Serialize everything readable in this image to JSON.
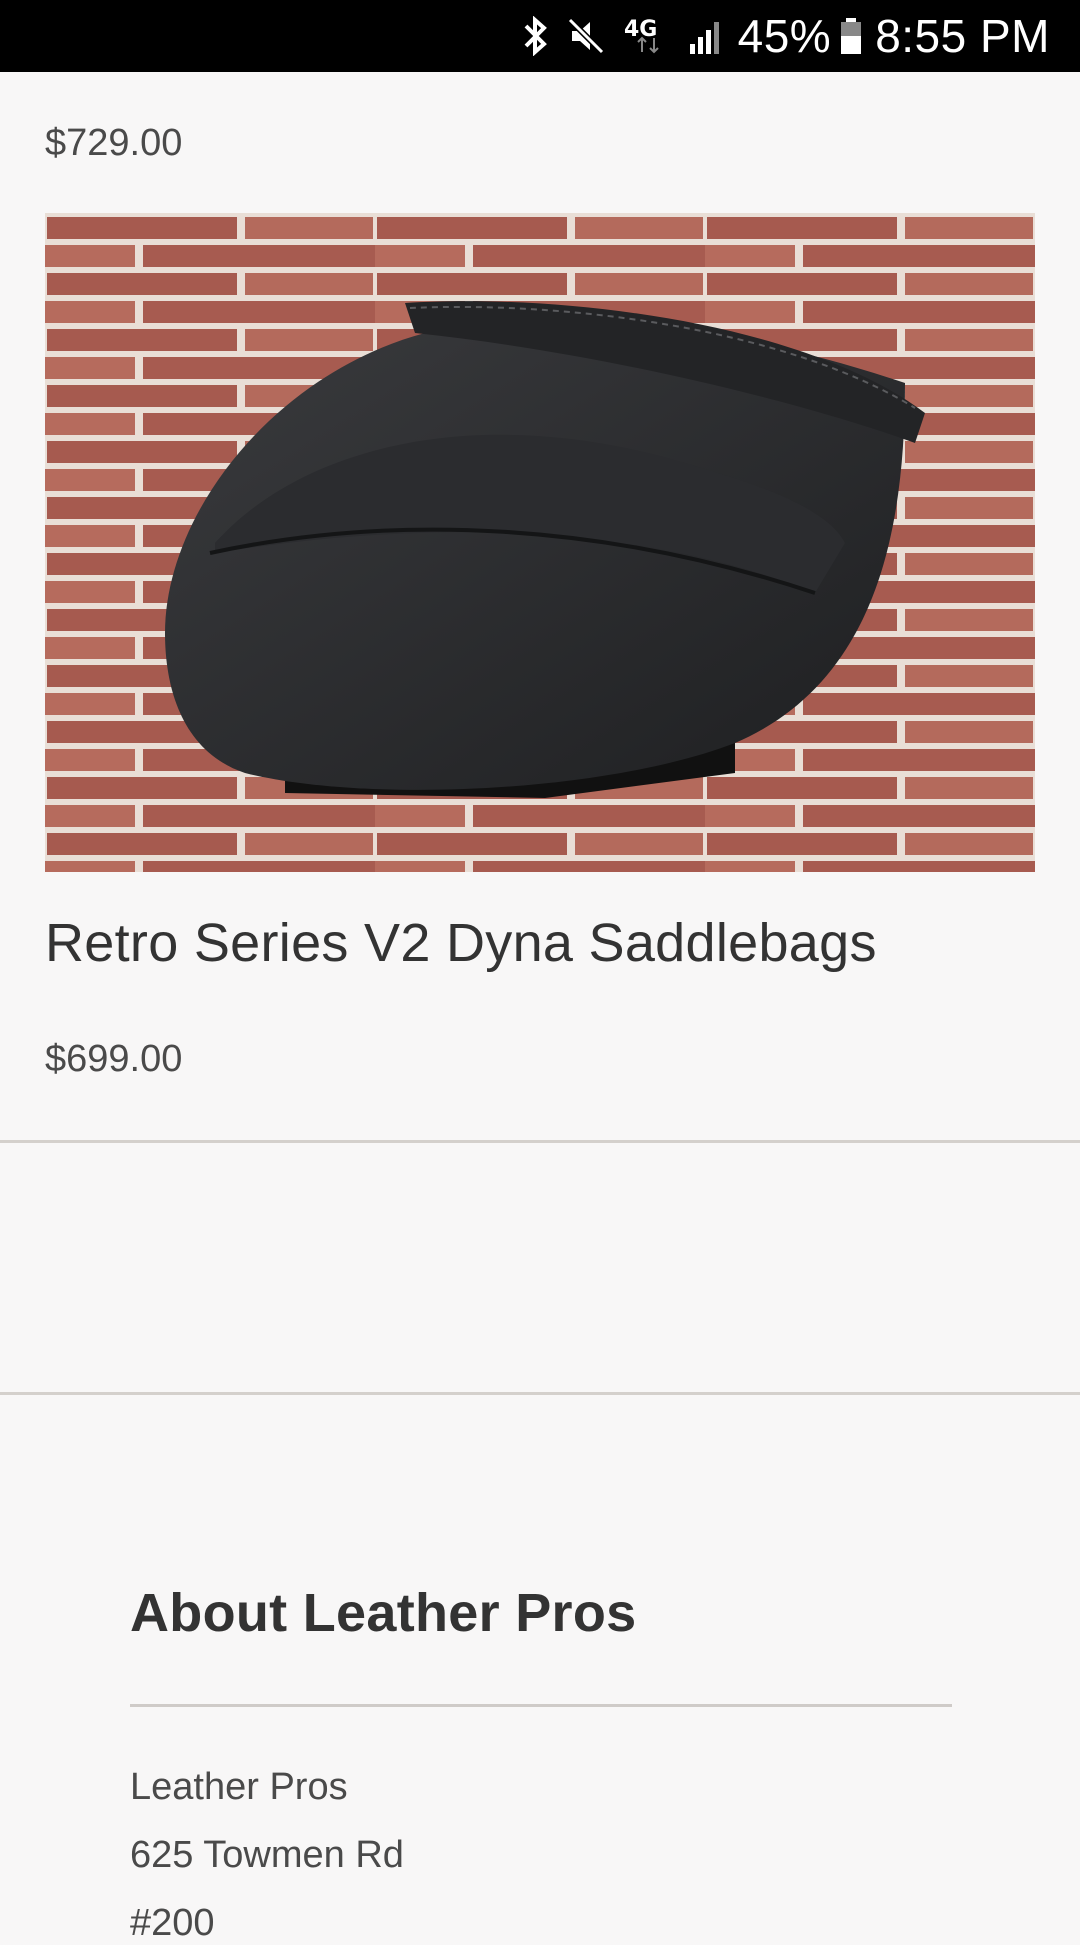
{
  "status_bar": {
    "icons": [
      "bluetooth-icon",
      "mute-icon",
      "4g-lte-icon",
      "signal-icon",
      "battery-icon"
    ],
    "network": "4G",
    "battery": "45%",
    "time": "8:55 PM"
  },
  "products": {
    "previous_price": "$729.00",
    "item": {
      "title": "Retro Series V2 Dyna Saddlebags",
      "price": "$699.00",
      "image_icon": "saddlebag-product-photo"
    }
  },
  "about": {
    "heading": "About Leather Pros",
    "address": [
      "Leather Pros",
      "625 Towmen Rd",
      "#200"
    ]
  },
  "colors": {
    "background": "#f8f7f7",
    "text": "#333333",
    "status_bar": "#000000",
    "brick": "#b0645a"
  }
}
